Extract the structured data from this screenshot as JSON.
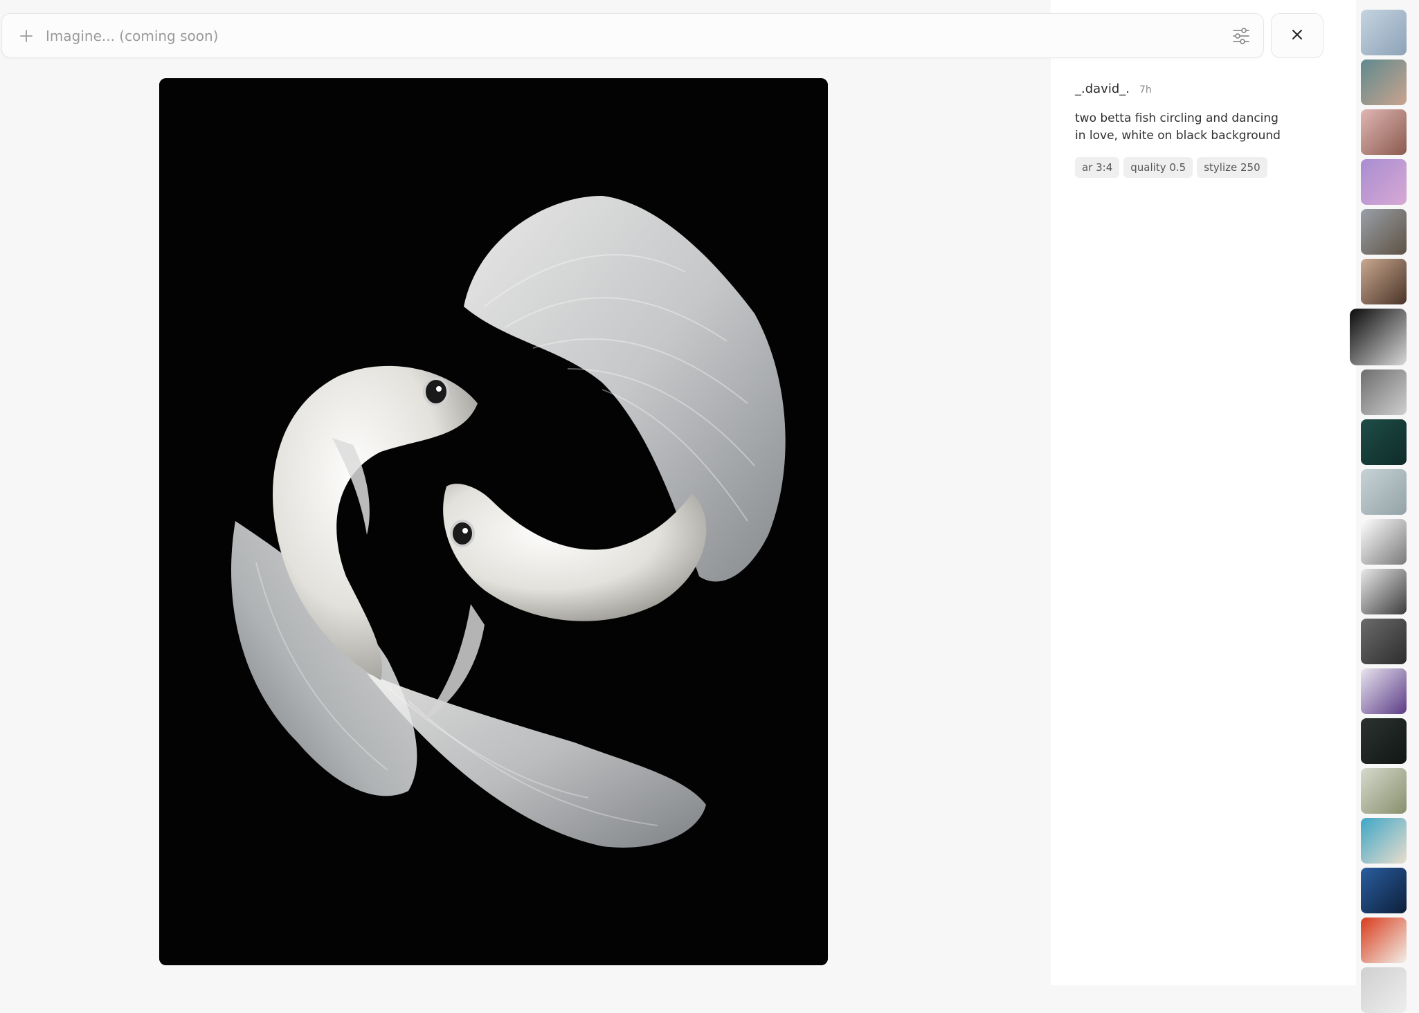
{
  "prompt_bar": {
    "placeholder": "Imagine... (coming soon)",
    "add_icon": "plus-icon",
    "settings_icon": "sliders-icon"
  },
  "close_icon": "close-icon",
  "main_image": {
    "subject": "two white betta fish on black background"
  },
  "details": {
    "author": "_.david_.",
    "time": "7h",
    "prompt": "two betta fish circling and dancing in love, white on black background",
    "params": [
      "ar 3:4",
      "quality 0.5",
      "stylize 250"
    ]
  },
  "thumbnails": [
    {
      "colors": [
        "#c4d3e0",
        "#8ea3b8"
      ]
    },
    {
      "colors": [
        "#5f8a8f",
        "#c9a38d"
      ]
    },
    {
      "colors": [
        "#e0b6b4",
        "#8a5b4e"
      ]
    },
    {
      "colors": [
        "#a98dd1",
        "#d7a9d4"
      ]
    },
    {
      "colors": [
        "#9aa0a8",
        "#5e5244"
      ]
    },
    {
      "colors": [
        "#c9a88f",
        "#4a3428"
      ]
    },
    {
      "colors": [
        "#0a0a0a",
        "#d8d8d8"
      ],
      "active": true
    },
    {
      "colors": [
        "#6d6d6d",
        "#cfcfcf"
      ]
    },
    {
      "colors": [
        "#1f4d47",
        "#0f2b29"
      ]
    },
    {
      "colors": [
        "#c7d2d5",
        "#93a3a8"
      ]
    },
    {
      "colors": [
        "#ffffff",
        "#7a7a7a"
      ]
    },
    {
      "colors": [
        "#e9e9e9",
        "#3c3c3c"
      ]
    },
    {
      "colors": [
        "#6b6b6b",
        "#2d2d2d"
      ]
    },
    {
      "colors": [
        "#e8e4ef",
        "#5c3c86"
      ]
    },
    {
      "colors": [
        "#2c3330",
        "#111614"
      ]
    },
    {
      "colors": [
        "#d6d9cc",
        "#87906d"
      ]
    },
    {
      "colors": [
        "#3ea6c7",
        "#e9ddcc"
      ]
    },
    {
      "colors": [
        "#2a5ea0",
        "#0d1f3a"
      ]
    },
    {
      "colors": [
        "#d83b1c",
        "#f2efe8"
      ]
    },
    {
      "colors": [
        "#cfcfcf",
        "#eeeeee"
      ]
    }
  ]
}
